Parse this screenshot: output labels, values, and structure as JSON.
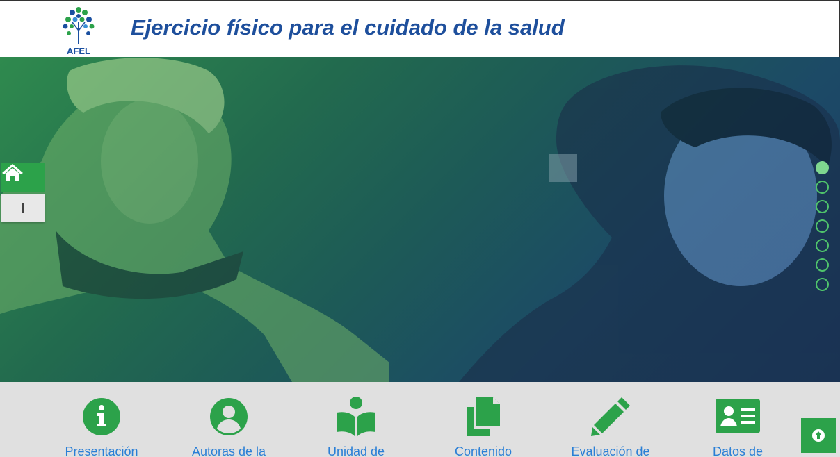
{
  "header": {
    "logo_text": "AFEL",
    "title": "Ejercicio físico para el cuidado de la salud"
  },
  "sidebar": {
    "home_icon": "home-icon",
    "label_button": "I"
  },
  "slider": {
    "dot_count": 7,
    "active_index": 0
  },
  "menu": {
    "items": [
      {
        "label": "Presentación",
        "icon": "info-circle-icon"
      },
      {
        "label": "Autoras de la",
        "icon": "user-circle-icon"
      },
      {
        "label": "Unidad de",
        "icon": "book-reader-icon"
      },
      {
        "label": "Contenido",
        "icon": "copy-files-icon"
      },
      {
        "label": "Evaluación de",
        "icon": "pencil-icon"
      },
      {
        "label": "Datos de",
        "icon": "id-card-icon"
      }
    ]
  },
  "scroll_top": {
    "icon": "arrow-up-circle-icon"
  },
  "colors": {
    "brand_green": "#2ca24a",
    "title_blue": "#1e4f9c",
    "link_blue": "#2a7fd6",
    "menu_bg": "#e0e0e0"
  }
}
